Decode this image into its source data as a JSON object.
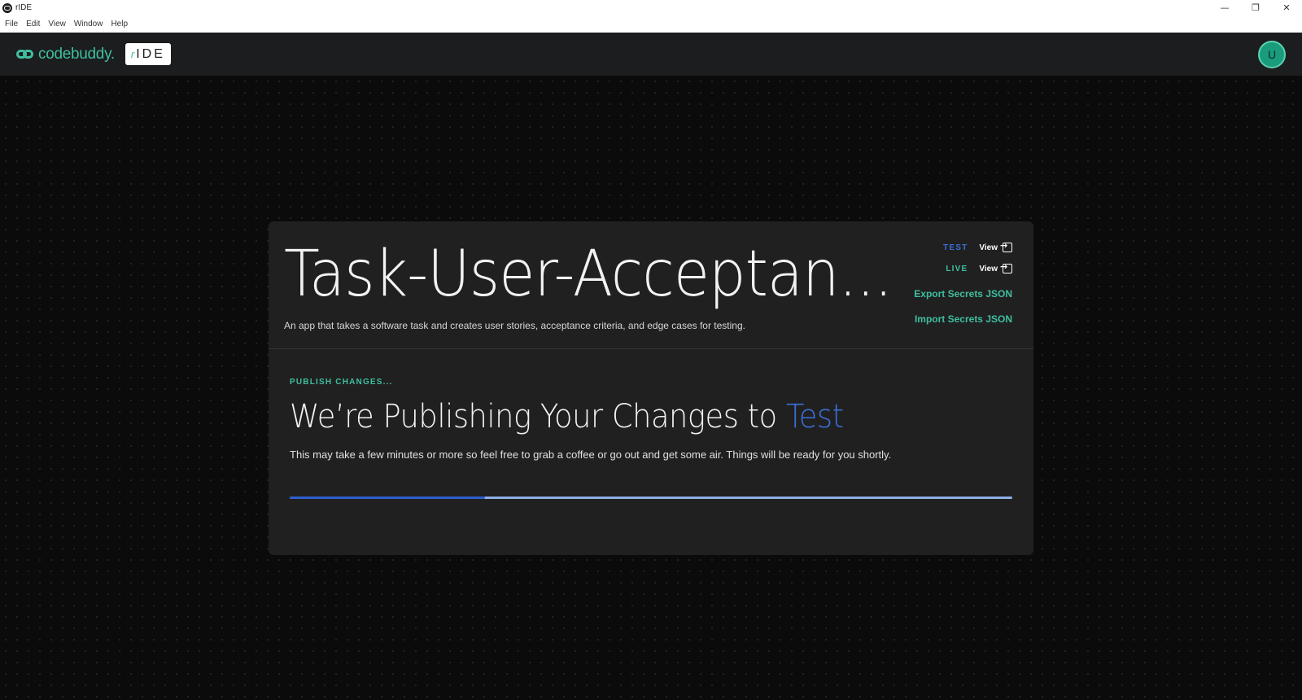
{
  "window": {
    "title": "rIDE"
  },
  "menu": [
    "File",
    "Edit",
    "View",
    "Window",
    "Help"
  ],
  "header": {
    "brand": "codebuddy.",
    "badge_r": "r",
    "badge_text": "IDE",
    "avatar_initial": "U"
  },
  "app": {
    "title": "Task-User-Acceptan...",
    "description": "An app that takes a software task and creates user stories, acceptance criteria, and edge cases for testing.",
    "environments": [
      {
        "label": "TEST",
        "link": "View"
      },
      {
        "label": "LIVE",
        "link": "View"
      }
    ],
    "export_secrets": "Export Secrets JSON",
    "import_secrets": "Import Secrets JSON"
  },
  "publish": {
    "kicker": "PUBLISH CHANGES...",
    "heading_prefix": "We’re Publishing Your Changes to",
    "heading_env": "Test",
    "subtext": "This may take a few minutes or more so feel free to grab a coffee or go out and get some air. Things will be ready for you shortly.",
    "progress": 0.27
  },
  "colors": {
    "accent_green": "#3fbfa0",
    "accent_blue": "#3a6fd8",
    "progress_fill": "#2d5fce",
    "progress_track": "#8fb0e6"
  }
}
